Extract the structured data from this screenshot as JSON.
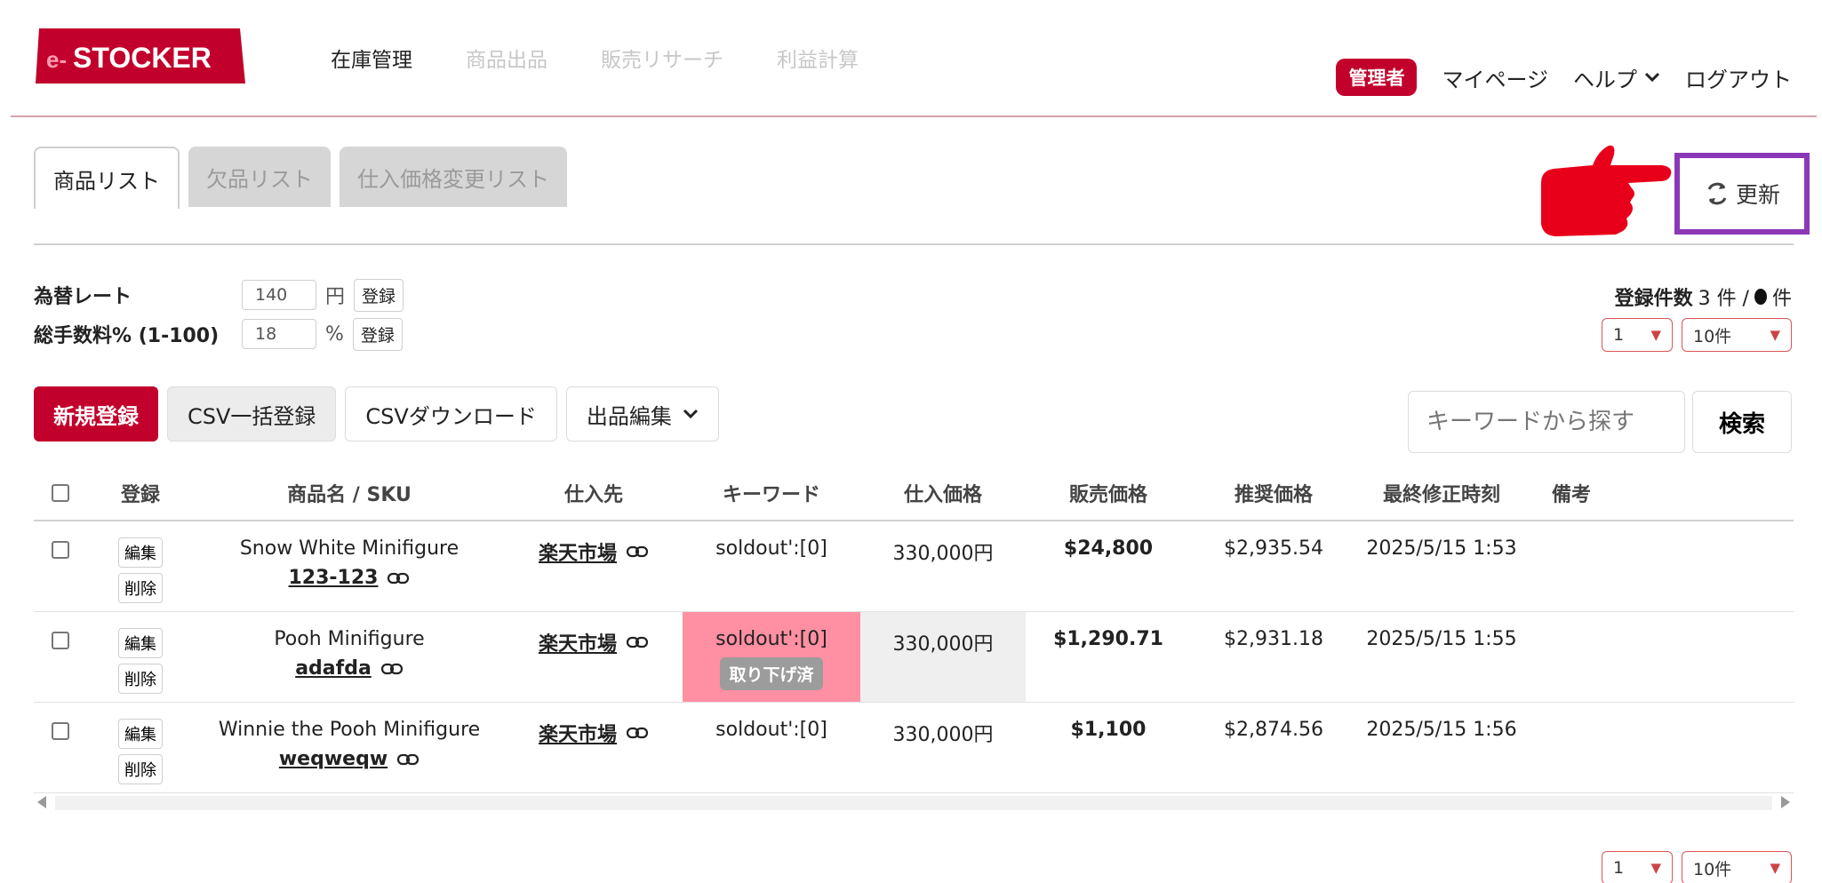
{
  "brand": {
    "logo_prefix": "e-",
    "logo_text": "STOCKER",
    "color": "#c2002c"
  },
  "nav": [
    {
      "label": "在庫管理",
      "active": true
    },
    {
      "label": "商品出品",
      "active": false
    },
    {
      "label": "販売リサーチ",
      "active": false
    },
    {
      "label": "利益計算",
      "active": false
    }
  ],
  "user_menu": {
    "admin_badge": "管理者",
    "mypage": "マイページ",
    "help": "ヘルプ",
    "logout": "ログアウト"
  },
  "tabs": [
    {
      "label": "商品リスト",
      "active": true
    },
    {
      "label": "欠品リスト",
      "active": false
    },
    {
      "label": "仕入価格変更リスト",
      "active": false
    }
  ],
  "update_button": {
    "label": "更新",
    "highlight_color": "#8c37b8"
  },
  "rates": {
    "exchange": {
      "label": "為替レート",
      "value": "140",
      "unit": "円",
      "button": "登録"
    },
    "fee": {
      "label": "総手数料% (1-100)",
      "value": "18",
      "unit": "%",
      "button": "登録"
    }
  },
  "registration": {
    "label": "登録件数",
    "count": "3 件 /",
    "suffix": "件"
  },
  "pager": {
    "page": "1",
    "per_page": "10件"
  },
  "actions": {
    "new": "新規登録",
    "csv_import": "CSV一括登録",
    "csv_download": "CSVダウンロード",
    "listing_edit": "出品編集"
  },
  "search": {
    "placeholder": "キーワードから探す",
    "button": "検索"
  },
  "table": {
    "headers": [
      "登録",
      "商品名 / SKU",
      "仕入先",
      "キーワード",
      "仕入価格",
      "販売価格",
      "推奨価格",
      "最終修正時刻",
      "備考"
    ],
    "edit_label": "編集",
    "delete_label": "削除",
    "rows": [
      {
        "name": "Snow White Minifigure",
        "sku": "123-123",
        "supplier": "楽天市場",
        "keyword": "soldout':[0]",
        "badge": "",
        "cost": "330,000円",
        "price": "$24,800",
        "recommended": "$2,935.54",
        "modified": "2025/5/15 1:53",
        "note": ""
      },
      {
        "name": "Pooh Minifigure",
        "sku": "adafda",
        "supplier": "楽天市場",
        "keyword": "soldout':[0]",
        "badge": "取り下げ済",
        "cost": "330,000円",
        "price": "$1,290.71",
        "recommended": "$2,931.18",
        "modified": "2025/5/15 1:55",
        "note": ""
      },
      {
        "name": "Winnie the Pooh Minifigure",
        "sku": "weqweqw",
        "supplier": "楽天市場",
        "keyword": "soldout':[0]",
        "badge": "",
        "cost": "330,000円",
        "price": "$1,100",
        "recommended": "$2,874.56",
        "modified": "2025/5/15 1:56",
        "note": ""
      }
    ]
  }
}
